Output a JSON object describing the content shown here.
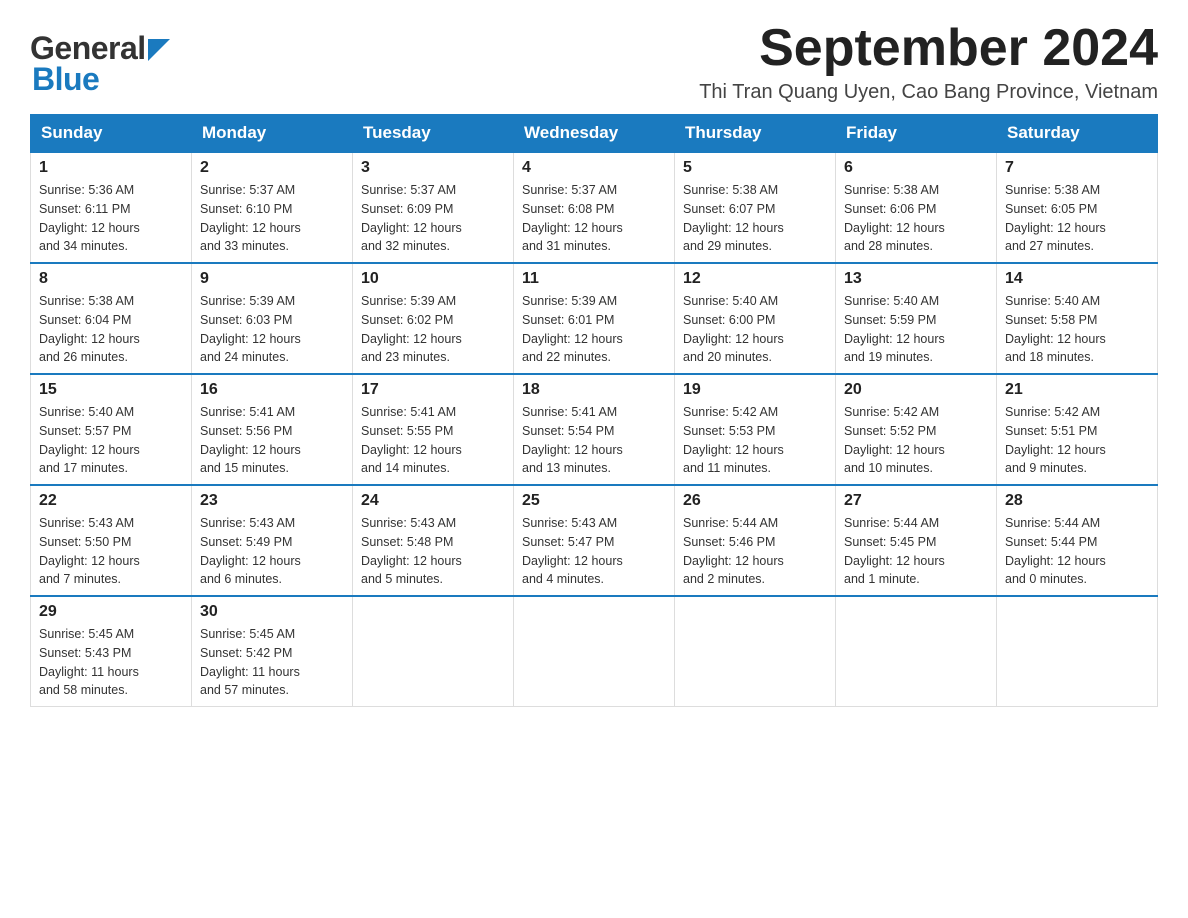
{
  "header": {
    "logo_general": "General",
    "logo_blue": "Blue",
    "month_title": "September 2024",
    "location": "Thi Tran Quang Uyen, Cao Bang Province, Vietnam"
  },
  "days_of_week": [
    "Sunday",
    "Monday",
    "Tuesday",
    "Wednesday",
    "Thursday",
    "Friday",
    "Saturday"
  ],
  "weeks": [
    [
      {
        "day": "1",
        "sunrise": "5:36 AM",
        "sunset": "6:11 PM",
        "daylight": "12 hours and 34 minutes."
      },
      {
        "day": "2",
        "sunrise": "5:37 AM",
        "sunset": "6:10 PM",
        "daylight": "12 hours and 33 minutes."
      },
      {
        "day": "3",
        "sunrise": "5:37 AM",
        "sunset": "6:09 PM",
        "daylight": "12 hours and 32 minutes."
      },
      {
        "day": "4",
        "sunrise": "5:37 AM",
        "sunset": "6:08 PM",
        "daylight": "12 hours and 31 minutes."
      },
      {
        "day": "5",
        "sunrise": "5:38 AM",
        "sunset": "6:07 PM",
        "daylight": "12 hours and 29 minutes."
      },
      {
        "day": "6",
        "sunrise": "5:38 AM",
        "sunset": "6:06 PM",
        "daylight": "12 hours and 28 minutes."
      },
      {
        "day": "7",
        "sunrise": "5:38 AM",
        "sunset": "6:05 PM",
        "daylight": "12 hours and 27 minutes."
      }
    ],
    [
      {
        "day": "8",
        "sunrise": "5:38 AM",
        "sunset": "6:04 PM",
        "daylight": "12 hours and 26 minutes."
      },
      {
        "day": "9",
        "sunrise": "5:39 AM",
        "sunset": "6:03 PM",
        "daylight": "12 hours and 24 minutes."
      },
      {
        "day": "10",
        "sunrise": "5:39 AM",
        "sunset": "6:02 PM",
        "daylight": "12 hours and 23 minutes."
      },
      {
        "day": "11",
        "sunrise": "5:39 AM",
        "sunset": "6:01 PM",
        "daylight": "12 hours and 22 minutes."
      },
      {
        "day": "12",
        "sunrise": "5:40 AM",
        "sunset": "6:00 PM",
        "daylight": "12 hours and 20 minutes."
      },
      {
        "day": "13",
        "sunrise": "5:40 AM",
        "sunset": "5:59 PM",
        "daylight": "12 hours and 19 minutes."
      },
      {
        "day": "14",
        "sunrise": "5:40 AM",
        "sunset": "5:58 PM",
        "daylight": "12 hours and 18 minutes."
      }
    ],
    [
      {
        "day": "15",
        "sunrise": "5:40 AM",
        "sunset": "5:57 PM",
        "daylight": "12 hours and 17 minutes."
      },
      {
        "day": "16",
        "sunrise": "5:41 AM",
        "sunset": "5:56 PM",
        "daylight": "12 hours and 15 minutes."
      },
      {
        "day": "17",
        "sunrise": "5:41 AM",
        "sunset": "5:55 PM",
        "daylight": "12 hours and 14 minutes."
      },
      {
        "day": "18",
        "sunrise": "5:41 AM",
        "sunset": "5:54 PM",
        "daylight": "12 hours and 13 minutes."
      },
      {
        "day": "19",
        "sunrise": "5:42 AM",
        "sunset": "5:53 PM",
        "daylight": "12 hours and 11 minutes."
      },
      {
        "day": "20",
        "sunrise": "5:42 AM",
        "sunset": "5:52 PM",
        "daylight": "12 hours and 10 minutes."
      },
      {
        "day": "21",
        "sunrise": "5:42 AM",
        "sunset": "5:51 PM",
        "daylight": "12 hours and 9 minutes."
      }
    ],
    [
      {
        "day": "22",
        "sunrise": "5:43 AM",
        "sunset": "5:50 PM",
        "daylight": "12 hours and 7 minutes."
      },
      {
        "day": "23",
        "sunrise": "5:43 AM",
        "sunset": "5:49 PM",
        "daylight": "12 hours and 6 minutes."
      },
      {
        "day": "24",
        "sunrise": "5:43 AM",
        "sunset": "5:48 PM",
        "daylight": "12 hours and 5 minutes."
      },
      {
        "day": "25",
        "sunrise": "5:43 AM",
        "sunset": "5:47 PM",
        "daylight": "12 hours and 4 minutes."
      },
      {
        "day": "26",
        "sunrise": "5:44 AM",
        "sunset": "5:46 PM",
        "daylight": "12 hours and 2 minutes."
      },
      {
        "day": "27",
        "sunrise": "5:44 AM",
        "sunset": "5:45 PM",
        "daylight": "12 hours and 1 minute."
      },
      {
        "day": "28",
        "sunrise": "5:44 AM",
        "sunset": "5:44 PM",
        "daylight": "12 hours and 0 minutes."
      }
    ],
    [
      {
        "day": "29",
        "sunrise": "5:45 AM",
        "sunset": "5:43 PM",
        "daylight": "11 hours and 58 minutes."
      },
      {
        "day": "30",
        "sunrise": "5:45 AM",
        "sunset": "5:42 PM",
        "daylight": "11 hours and 57 minutes."
      },
      null,
      null,
      null,
      null,
      null
    ]
  ],
  "labels": {
    "sunrise": "Sunrise:",
    "sunset": "Sunset:",
    "daylight": "Daylight:"
  }
}
